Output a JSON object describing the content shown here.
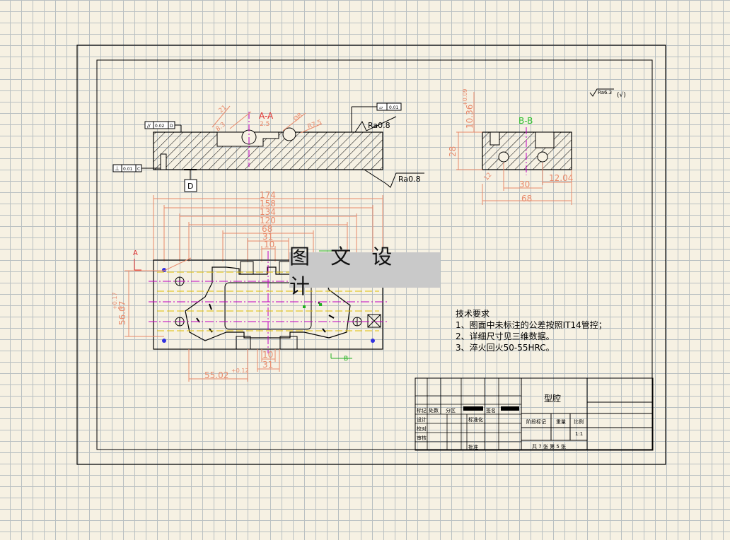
{
  "sections": {
    "aa": "A-A",
    "bb": "B-B",
    "a": "A",
    "b": "B",
    "d": "D"
  },
  "symbols": {
    "ra_top": "Ra0.8",
    "ra_bottom": "Ra0.8",
    "ra_corner": "Ra6.3",
    "ra_corner_note": "(√)",
    "flatness": "0.01",
    "parallelism": "0.02",
    "parallelism_ref": "D",
    "perpendicularity": "0.01",
    "perpendicularity_ref": "C"
  },
  "dims_top": [
    "174",
    "158",
    "134",
    "120",
    "68",
    "31",
    "10"
  ],
  "dims_left": "56.07",
  "dims_left_tol": "+0.17",
  "dims_left_tol2": "0",
  "dims_bottom": [
    "10",
    "31"
  ],
  "dims_bottom_main": "55.02",
  "dims_bottom_tol": "+0.12",
  "dims_bb": {
    "height": "28",
    "slot": "10.36",
    "slot_tol": "+0.09",
    "d30": "30",
    "d1204": "12.04",
    "d68": "68",
    "d12": "12"
  },
  "dims_aa": [
    "8.3",
    "Ø8",
    "R7.5",
    "21",
    "2.5"
  ],
  "watermark": "图 文 设 计",
  "tech_notes": {
    "title": "技术要求",
    "items": [
      "1、图面中未标注的公差按照IT14管控；",
      "2、详细尺寸见三维数据。",
      "3、淬火回火50-55HRC。"
    ]
  },
  "title_block": {
    "part_name": "型腔",
    "biaoji": "标记",
    "chushu": "处数",
    "fenqu": "分区",
    "qianming": "签名",
    "sheji": "设计",
    "biaozhunhua": "标准化",
    "jiaodui": "校对",
    "shenhe": "审核",
    "pizhun": "批准",
    "jieduan": "阶段标记",
    "zhongliang": "重量",
    "bili": "比例",
    "scale": "1:1",
    "sheets": "共 7 张    第 5 张"
  },
  "colors": {
    "dim": "#e8896a",
    "center": "#c000c0",
    "section_label": "#e03030",
    "bb_label": "#30c030",
    "yellow": "#e0c000",
    "blue": "#3030e0",
    "green": "#20b020"
  }
}
